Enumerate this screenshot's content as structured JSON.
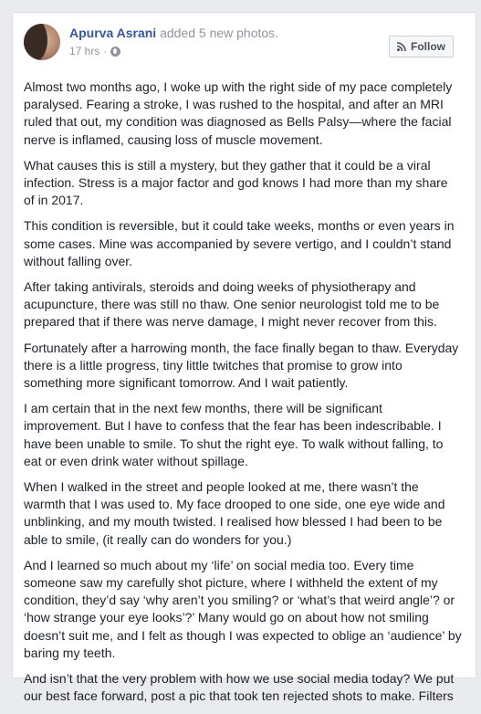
{
  "post": {
    "author": "Apurva Asrani",
    "action": "added 5 new photos.",
    "timestamp": "17 hrs",
    "separator": "·",
    "privacy_icon": "globe-icon",
    "follow_label": "Follow",
    "follow_icon": "rss-icon"
  },
  "paragraphs": [
    "Almost two months ago, I woke up with the right side of my pace completely paralysed. Fearing a stroke, I was rushed to the hospital, and after an MRI ruled that out, my condition was diagnosed as Bells Palsy—where the facial nerve is inflamed, causing loss of muscle movement.",
    "What causes this is still a mystery, but they gather that it could be a viral infection. Stress is a major factor and god knows I had more than my share of in 2017.",
    "This condition is reversible, but it could take weeks, months or even years in some cases. Mine was accompanied by severe vertigo, and I couldn’t stand without falling over.",
    "After taking antivirals, steroids and doing weeks of physiotherapy and acupuncture, there was still no thaw. One senior neurologist told me to be prepared that if there was nerve damage, I might never recover from this.",
    "Fortunately after a harrowing month, the face finally began to thaw. Everyday there is a little progress, tiny little twitches that promise to grow into something more significant tomorrow. And I wait patiently.",
    "I am certain that in the next few months, there will be significant improvement. But I have to confess that the fear has been indescribable. I have been unable to smile. To shut the right eye. To walk without falling, to eat or even drink water without spillage.",
    "When I walked in the street and people looked at me, there wasn’t the warmth that I was used to. My face drooped to one side, one eye wide and unblinking, and my mouth twisted. I realised how blessed I had been to be able to smile, (it really can do wonders for you.)",
    "And I learned so much about my ‘life’ on social media too. Every time someone saw my carefully shot picture, where I withheld the extent of my condition, they’d say ‘why aren’t you smiling? or ‘what’s that weird angle’? or ‘how strange your eye looks’?’ Many would go on about how not smiling doesn’t suit me, and I felt as though I was expected to oblige an ‘audience’ by baring my teeth.",
    "And isn’t that the very problem with how we use social media today? We put our best face forward, post a pic that took ten rejected shots to make. Filters"
  ],
  "colors": {
    "author_link": "#365899",
    "body_text": "#1d2129",
    "meta_text": "#90949c",
    "page_bg": "#e9ebee"
  }
}
